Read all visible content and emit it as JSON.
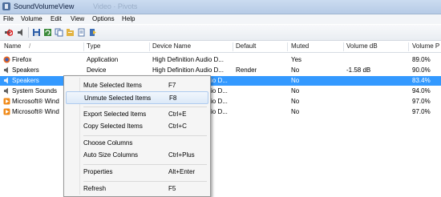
{
  "window": {
    "title": "SoundVolumeView",
    "background_title": "Video · Pivots"
  },
  "menu": [
    "File",
    "Volume",
    "Edit",
    "View",
    "Options",
    "Help"
  ],
  "toolbar": {
    "buttons": [
      "mute-icon",
      "unmute-icon",
      "save-icon",
      "refresh-icon",
      "copy-icon",
      "properties-icon",
      "html-report-icon",
      "exit-icon"
    ]
  },
  "columns": [
    "Name",
    "Type",
    "Device Name",
    "Default",
    "Muted",
    "Volume dB",
    "Volume P"
  ],
  "rows": [
    {
      "icon": "firefox-icon",
      "name": "Firefox",
      "type": "Application",
      "device": "High Definition Audio D...",
      "default": "",
      "muted": "Yes",
      "db": "",
      "pct": "89.0%"
    },
    {
      "icon": "speaker-icon",
      "name": "Speakers",
      "type": "Device",
      "device": "High Definition Audio D...",
      "default": "Render",
      "muted": "No",
      "db": "-1.58 dB",
      "pct": "90.0%"
    },
    {
      "icon": "speaker-icon",
      "name": "Speakers",
      "type": "",
      "device": "io D...",
      "default": "",
      "muted": "No",
      "db": "",
      "pct": "83.4%"
    },
    {
      "icon": "speaker-icon",
      "name": "System Sounds",
      "type": "",
      "device": "io D...",
      "default": "",
      "muted": "No",
      "db": "",
      "pct": "94.0%"
    },
    {
      "icon": "media-player-icon",
      "name": "Microsoft® Wind",
      "type": "",
      "device": "io D...",
      "default": "",
      "muted": "No",
      "db": "",
      "pct": "97.0%"
    },
    {
      "icon": "media-player-icon",
      "name": "Microsoft® Wind",
      "type": "",
      "device": "io D...",
      "default": "",
      "muted": "No",
      "db": "",
      "pct": "97.0%"
    }
  ],
  "context_menu": [
    {
      "label": "Mute Selected Items",
      "shortcut": "F7"
    },
    {
      "label": "Unmute Selected Items",
      "shortcut": "F8"
    },
    {
      "label": "Export Selected Items",
      "shortcut": "Ctrl+E"
    },
    {
      "label": "Copy Selected Items",
      "shortcut": "Ctrl+C"
    },
    {
      "label": "Choose Columns",
      "shortcut": ""
    },
    {
      "label": "Auto Size Columns",
      "shortcut": "Ctrl+Plus"
    },
    {
      "label": "Properties",
      "shortcut": "Alt+Enter"
    },
    {
      "label": "Refresh",
      "shortcut": "F5"
    }
  ],
  "colors": {
    "selection": "#3399ff",
    "menu_highlight": "#dce9f8"
  }
}
